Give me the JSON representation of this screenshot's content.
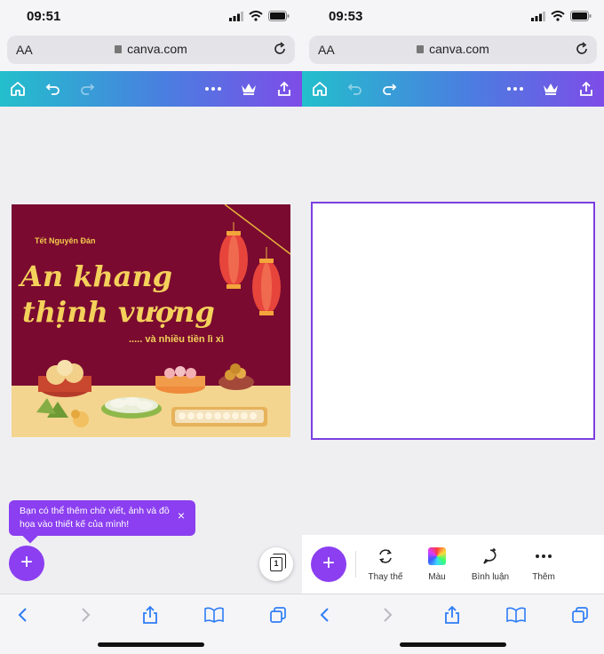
{
  "left": {
    "status": {
      "time": "09:51"
    },
    "browser": {
      "aa_label": "AA",
      "url": "canva.com"
    },
    "design": {
      "subtitle": "Tết Nguyên Đán",
      "title_line1": "An khang",
      "title_line2": "thịnh vượng",
      "tagline": "..... và nhiều tiền lì xì"
    },
    "tooltip": {
      "text": "Bạn có thể thêm chữ viết, ảnh và đồ họa vào thiết kế của mình!",
      "close": "×"
    },
    "fab_label": "+",
    "page_count": "1"
  },
  "right": {
    "status": {
      "time": "09:53"
    },
    "browser": {
      "aa_label": "AA",
      "url": "canva.com"
    },
    "fab_label": "+",
    "toolbar": {
      "replace_label": "Thay thế",
      "color_label": "Màu",
      "comment_label": "Bình luận",
      "more_label": "Thêm"
    }
  },
  "icons": {
    "home": "home-icon",
    "undo": "undo-icon",
    "redo": "redo-icon",
    "more": "more-dots-icon",
    "crown": "crown-icon",
    "share": "share-icon",
    "back": "chevron-left-icon",
    "forward": "chevron-right-icon",
    "bookmarks": "book-icon",
    "tabs": "tabs-icon"
  },
  "colors": {
    "canva_purple": "#8b3ff0",
    "gradient_start": "#23bfcc",
    "gradient_end": "#7e4ce8",
    "poster_bg": "#7a0a30",
    "poster_text": "#f4d15b"
  }
}
